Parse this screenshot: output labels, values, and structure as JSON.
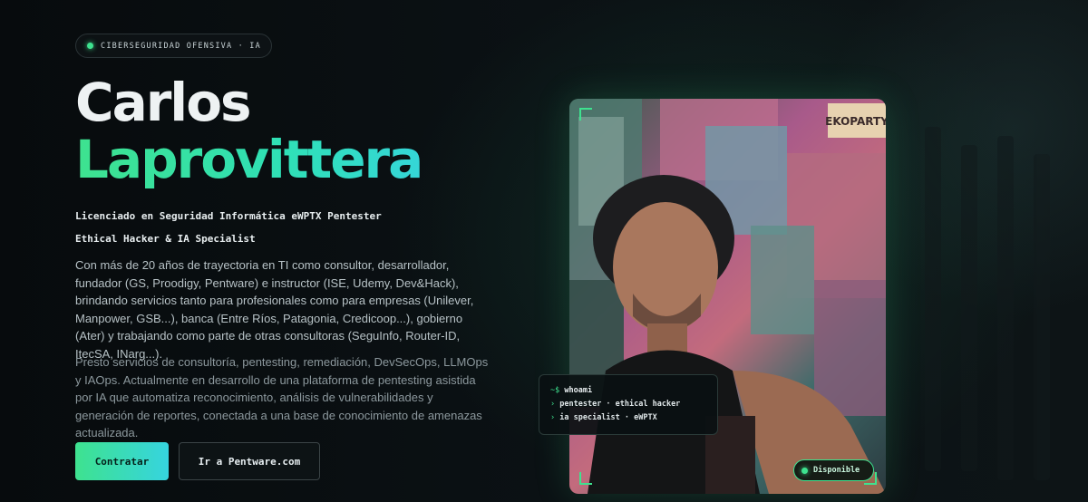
{
  "badge": {
    "dot_icon": "status-dot-icon",
    "label": "CIBERSEGURIDAD OFENSIVA · IA"
  },
  "hero": {
    "first_name": "Carlos",
    "last_name": "Laprovittera",
    "subtitle_line1": "Licenciado en Seguridad Informática  eWPTX  Pentester",
    "subtitle_line2": "Ethical Hacker & IA Specialist",
    "paragraph1": "Con más de 20 años de trayectoria en TI como consultor, desarrollador, fundador (GS, Proodigy, Pentware) e instructor (ISE, Udemy, Dev&Hack), brindando servicios tanto para profesionales como para empresas (Unilever, Manpower, GSB...), banca (Entre Ríos, Patagonia, Credicoop...), gobierno (Ater) y trabajando como parte de otras consultoras (SeguInfo, Router-ID, ItecSA, INarg...).",
    "paragraph2": "Presto servicios de consultoría, pentesting, remediación, DevSecOps, LLMOps y IAOps. Actualmente en desarrollo de una plataforma de pentesting asistida por IA que automatiza reconocimiento, análisis de vulnerabilidades y generación de reportes, conectada a una base de conocimiento de amenazas actualizada."
  },
  "buttons": {
    "primary": "Contratar",
    "secondary": "Ir a Pentware.com"
  },
  "terminal": {
    "prompt": "~$",
    "command": "whoami",
    "arrow": "›",
    "line1": "pentester · ethical hacker",
    "line2": "ia specialist · eWPTX"
  },
  "photo": {
    "sign_text": "EKOPARTY"
  },
  "status": {
    "label": "Disponible"
  },
  "colors": {
    "accent": "#3ee28f",
    "accent2": "#35d6d8",
    "background": "#0a0f12"
  }
}
